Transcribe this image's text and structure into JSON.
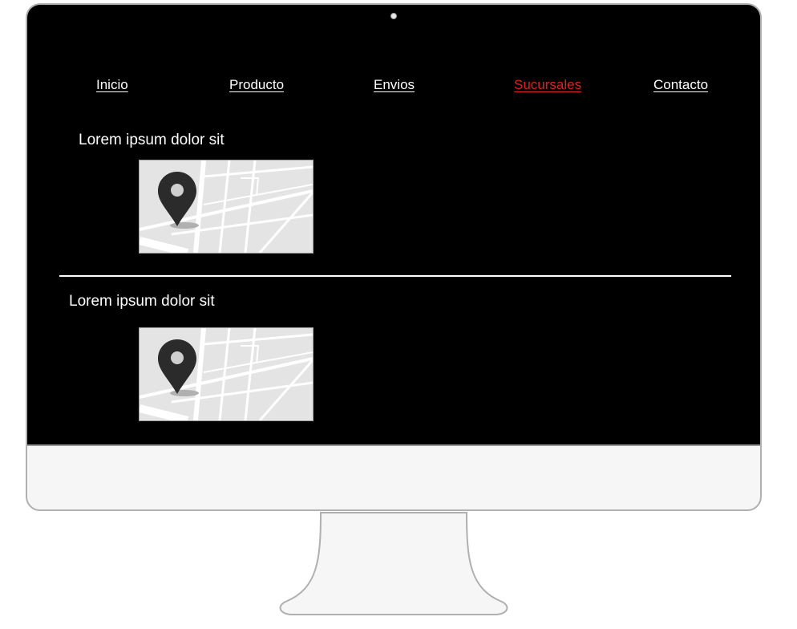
{
  "nav": {
    "items": [
      {
        "label": "Inicio",
        "active": false
      },
      {
        "label": "Producto",
        "active": false
      },
      {
        "label": "Envios",
        "active": false
      },
      {
        "label": "Sucursales",
        "active": true
      },
      {
        "label": "Contacto",
        "active": false
      }
    ],
    "active_color": "#e02020"
  },
  "branches": [
    {
      "title": "Lorem ipsum dolor sit",
      "map_icon": "map-pin-icon"
    },
    {
      "title": "Lorem ipsum dolor sit",
      "map_icon": "map-pin-icon"
    }
  ],
  "colors": {
    "screen_background": "#000000",
    "text": "#ffffff",
    "map_background": "#e4e4e4",
    "pin": "#2b2b2b"
  }
}
